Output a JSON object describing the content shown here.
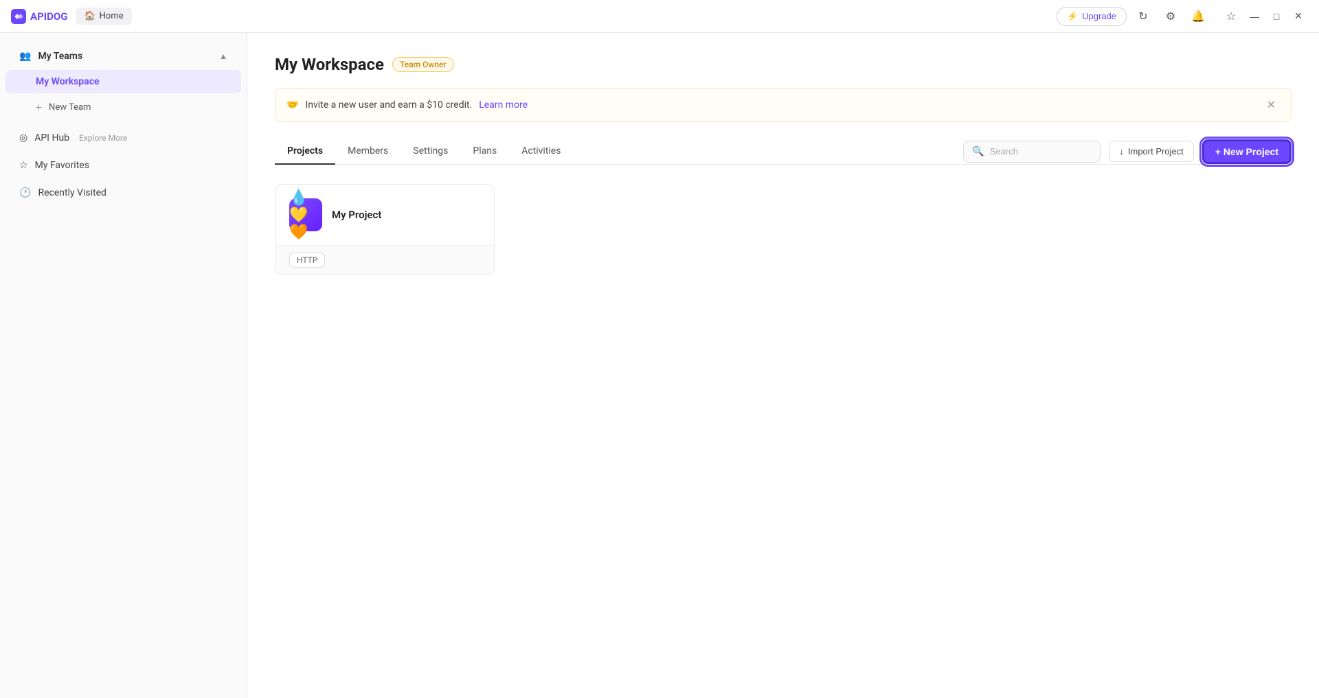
{
  "app": {
    "name": "APIDOG",
    "logo_text": "APIDOG"
  },
  "titlebar": {
    "home_tab": "Home",
    "upgrade_label": "Upgrade",
    "refresh_icon": "↻",
    "settings_icon": "⚙",
    "bell_icon": "🔔",
    "star_icon": "☆",
    "minimize_icon": "—",
    "maximize_icon": "□",
    "close_icon": "✕"
  },
  "sidebar": {
    "my_teams_label": "My Teams",
    "my_workspace_label": "My Workspace",
    "new_team_label": "New Team",
    "api_hub_label": "API Hub",
    "api_hub_secondary": "Explore More",
    "my_favorites_label": "My Favorites",
    "recently_visited_label": "Recently Visited"
  },
  "main": {
    "page_title": "My Workspace",
    "team_owner_badge": "Team Owner",
    "invite_text": "Invite a new user and earn a $10 credit.",
    "invite_link_text": "Learn more",
    "tabs": [
      {
        "id": "projects",
        "label": "Projects",
        "active": true
      },
      {
        "id": "members",
        "label": "Members",
        "active": false
      },
      {
        "id": "settings",
        "label": "Settings",
        "active": false
      },
      {
        "id": "plans",
        "label": "Plans",
        "active": false
      },
      {
        "id": "activities",
        "label": "Activities",
        "active": false
      }
    ],
    "search_placeholder": "Search",
    "import_project_label": "Import Project",
    "new_project_label": "+ New Project",
    "projects": [
      {
        "id": "my-project",
        "name": "My Project",
        "icon_emoji": "💧💛🧡",
        "type": "HTTP"
      }
    ]
  }
}
